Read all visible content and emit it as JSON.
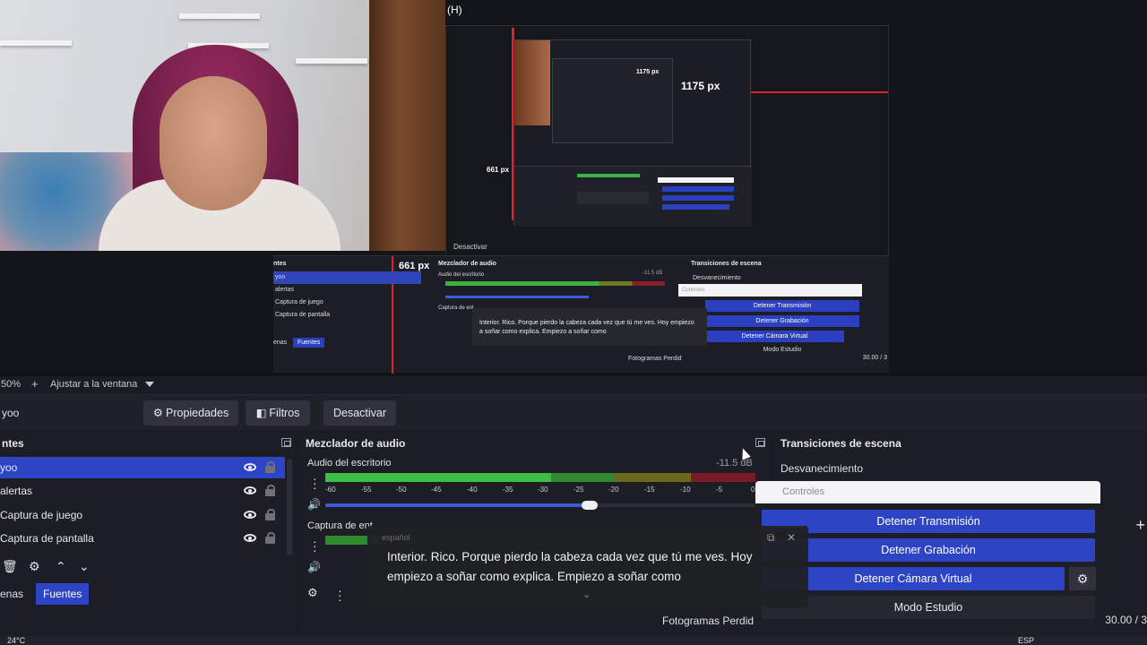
{
  "preview": {
    "nested_label_h": "(H)",
    "px_label_width": "1175 px",
    "px_label_height": "661 px",
    "nested_deactivate": "Desactivar",
    "nested": {
      "sources_title": "ntes",
      "sources": [
        "yoo",
        "alertas",
        "Captura de juego",
        "Captura de pantalla"
      ],
      "tab_scenes": "enas",
      "tab_sources": "Fuentes",
      "mixer_title": "Mezclador de audio",
      "mixer_track": "Audio del escritorio",
      "mixer_track2": "Captura de ent",
      "mixer_db": "-11.5 dB",
      "trans_title": "Transiciones de escena",
      "trans_select": "Desvanecimiento",
      "controls_title": "Controles",
      "btn_stream": "Detener Transmisión",
      "btn_record": "Detener Grabación",
      "btn_vcam": "Detener Cámara Virtual",
      "btn_studio": "Modo Estudio",
      "caption": "Interior. Rico. Porque pierdo la cabeza cada vez que tú me ves. Hoy empiezo a soñar como explica. Empiezo a soñar como",
      "dropped": "Fotogramas Perdid",
      "fps": "30.00 / 3"
    }
  },
  "zoombar": {
    "zoom": "50%",
    "plus": "+",
    "fit": "Ajustar a la ventana"
  },
  "toolbar": {
    "scene": "yoo",
    "properties": "Propiedades",
    "filters": "Filtros",
    "deactivate": "Desactivar"
  },
  "sources": {
    "title": "ntes",
    "items": [
      {
        "name": "yoo",
        "selected": true
      },
      {
        "name": "alertas",
        "selected": false
      },
      {
        "name": "Captura de juego",
        "selected": false
      },
      {
        "name": "Captura de pantalla",
        "selected": false
      }
    ],
    "tab_scenes": "enas",
    "tab_sources": "Fuentes"
  },
  "mixer": {
    "title": "Mezclador de audio",
    "track1": {
      "name": "Audio del escritorio",
      "db": "-11.5 dB"
    },
    "track2": {
      "name": "Captura de ent",
      "db": ""
    },
    "ticks": [
      "-60",
      "-55",
      "-50",
      "-45",
      "-40",
      "-35",
      "-30",
      "-25",
      "-20",
      "-15",
      "-10",
      "-5",
      "0"
    ]
  },
  "transitions": {
    "title": "Transiciones de escena",
    "selected": "Desvanecimiento",
    "fps": "30.00 / 3"
  },
  "controls": {
    "title": "Controles",
    "stop_stream": "Detener Transmisión",
    "stop_record": "Detener Grabación",
    "stop_vcam": "Detener Cámara Virtual",
    "studio_mode": "Modo Estudio"
  },
  "caption": {
    "language": "español",
    "text": "Interior. Rico. Porque pierdo la cabeza cada vez que tú me ves. Hoy empiezo a soñar como explica. Empiezo a soñar como"
  },
  "status": {
    "dropped_frames": "Fotogramas Perdid"
  },
  "taskbar": {
    "weather": "24°C",
    "lang": "ESP"
  },
  "colors": {
    "accent": "#2d44c4",
    "meter_green": "#3cb043",
    "meter_red": "#8c1e2a",
    "guide_red": "#e0202a"
  }
}
